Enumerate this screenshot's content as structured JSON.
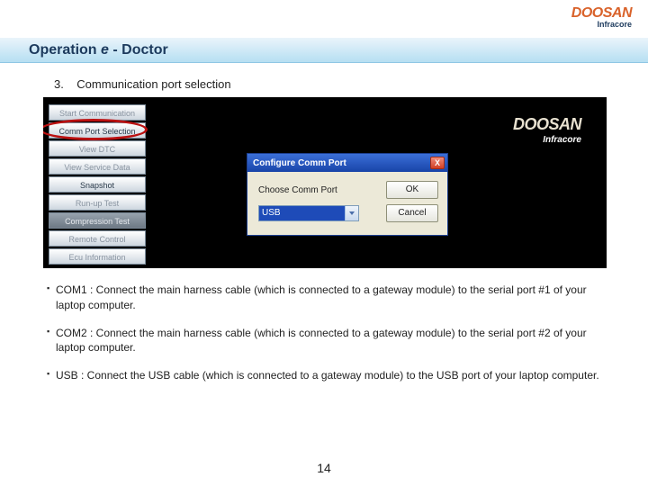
{
  "brand": {
    "logo": "DOOSAN",
    "subbrand": "Infracore"
  },
  "title": {
    "prefix": "Operation ",
    "ital": "e",
    "suffix": " - Doctor"
  },
  "section": {
    "number": "3.",
    "heading": "Communication port selection"
  },
  "side_menu": [
    {
      "label": "Start Communication",
      "style": "dim"
    },
    {
      "label": "Comm Port Selection",
      "style": "normal"
    },
    {
      "label": "View DTC",
      "style": "dim"
    },
    {
      "label": "View Service Data",
      "style": "dim"
    },
    {
      "label": "Snapshot",
      "style": "normal"
    },
    {
      "label": "Run-up Test",
      "style": "dim"
    },
    {
      "label": "Compression Test",
      "style": "dark"
    },
    {
      "label": "Remote Control",
      "style": "dim"
    },
    {
      "label": "Ecu Information",
      "style": "dim"
    }
  ],
  "app_logo": {
    "word": "DOOSAN",
    "sub": "Infracore"
  },
  "dialog": {
    "title": "Configure Comm Port",
    "label": "Choose Comm Port",
    "selected": "USB",
    "ok": "OK",
    "cancel": "Cancel"
  },
  "notes": [
    "COM1 : Connect the main harness cable (which is connected to a gateway module) to the serial port #1 of your laptop computer.",
    "COM2 : Connect the main harness cable (which is connected to a gateway module) to the serial port #2 of your laptop computer.",
    "USB : Connect the USB cable (which is connected to a gateway module) to the USB port of your laptop computer."
  ],
  "page_number": "14"
}
